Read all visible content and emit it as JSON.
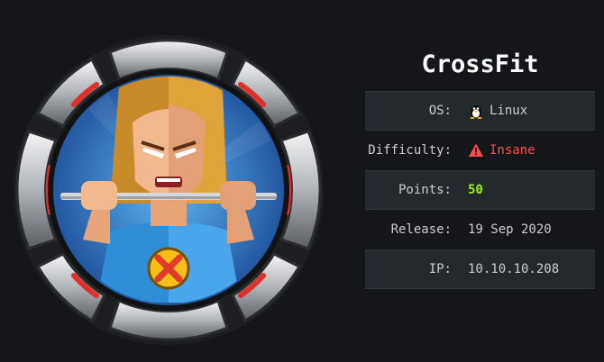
{
  "machine": {
    "name": "CrossFit",
    "badge_icon": "crossfit-avatar-badge"
  },
  "info": {
    "os_label": "OS:",
    "os_value": "Linux",
    "os_icon": "linux-tux-icon",
    "difficulty_label": "Difficulty:",
    "difficulty_value": "Insane",
    "difficulty_icon": "warning-icon",
    "points_label": "Points:",
    "points_value": "50",
    "release_label": "Release:",
    "release_value": "19 Sep 2020",
    "ip_label": "IP:",
    "ip_value": "10.10.10.208"
  },
  "colors": {
    "background": "#141619",
    "row_alt": "#24292e",
    "insane": "#ff4d4d",
    "points": "#9fef00"
  }
}
